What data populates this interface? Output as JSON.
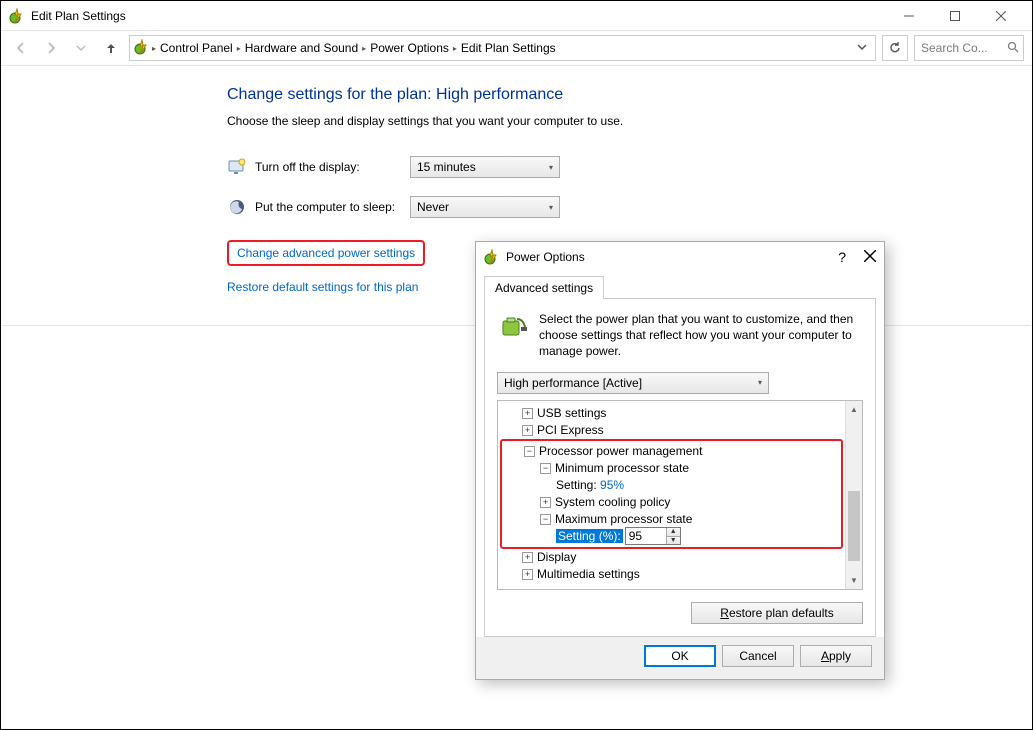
{
  "window": {
    "title": "Edit Plan Settings"
  },
  "breadcrumb": {
    "items": [
      "Control Panel",
      "Hardware and Sound",
      "Power Options",
      "Edit Plan Settings"
    ]
  },
  "search": {
    "placeholder": "Search Co..."
  },
  "plan": {
    "heading": "Change settings for the plan: High performance",
    "subheading": "Choose the sleep and display settings that you want your computer to use.",
    "display_off_label": "Turn off the display:",
    "display_off_value": "15 minutes",
    "sleep_label": "Put the computer to sleep:",
    "sleep_value": "Never",
    "advanced_link": "Change advanced power settings",
    "restore_link": "Restore default settings for this plan"
  },
  "dialog": {
    "title": "Power Options",
    "tab": "Advanced settings",
    "description": "Select the power plan that you want to customize, and then choose settings that reflect how you want your computer to manage power.",
    "plan_selector": "High performance [Active]",
    "tree": {
      "usb": "USB settings",
      "pci": "PCI Express",
      "proc": "Processor power management",
      "min_state": "Minimum processor state",
      "min_setting_label": "Setting:",
      "min_setting_value": "95%",
      "cooling": "System cooling policy",
      "max_state": "Maximum processor state",
      "max_setting_label": "Setting (%):",
      "max_setting_value": "95",
      "display": "Display",
      "multimedia": "Multimedia settings"
    },
    "restore_btn": "Restore plan defaults",
    "ok": "OK",
    "cancel": "Cancel",
    "apply": "Apply"
  }
}
